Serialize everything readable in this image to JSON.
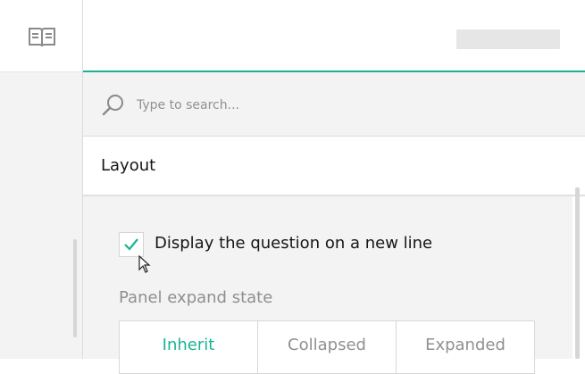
{
  "search": {
    "placeholder": "Type to search..."
  },
  "section": {
    "title": "Layout"
  },
  "checkbox": {
    "label": "Display the question on a new line",
    "checked": true
  },
  "panel_expand": {
    "label": "Panel expand state",
    "options": [
      "Inherit",
      "Collapsed",
      "Expanded"
    ],
    "selected": "Inherit"
  },
  "colors": {
    "accent": "#19b394",
    "panel_bg": "#f3f3f3",
    "text": "#161616",
    "muted": "#909090"
  },
  "icons": {
    "sidebar_book": "book-icon",
    "search": "search-icon",
    "check": "checkmark-icon"
  }
}
